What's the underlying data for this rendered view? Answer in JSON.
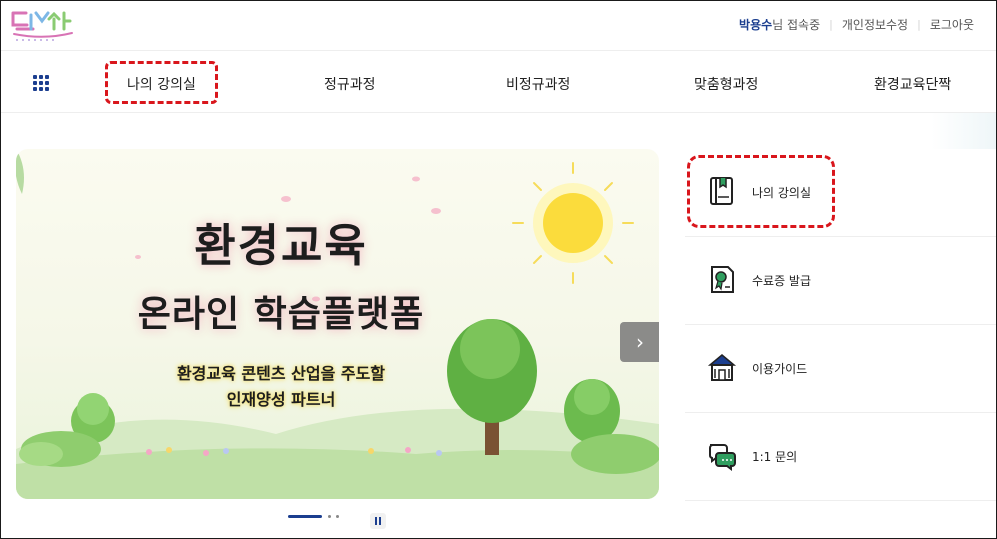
{
  "header": {
    "user_name": "박용수",
    "user_suffix": "님 접속중",
    "links": [
      "개인정보수정",
      "로그아웃"
    ]
  },
  "nav": {
    "items": [
      "나의 강의실",
      "정규과정",
      "비정규과정",
      "맞춤형과정",
      "환경교육단짝"
    ]
  },
  "banner": {
    "title": "환경교육",
    "subtitle": "온라인 학습플랫폼",
    "tagline": [
      "환경교육 콘텐츠 산업을 주도할",
      "인재양성 파트너"
    ],
    "next_icon": "chevron-right-icon"
  },
  "side_menu": {
    "items": [
      {
        "label": "나의 강의실",
        "icon": "book-icon"
      },
      {
        "label": "수료증 발급",
        "icon": "certificate-icon"
      },
      {
        "label": "이용가이드",
        "icon": "building-icon"
      },
      {
        "label": "1:1 문의",
        "icon": "chat-icon"
      }
    ]
  },
  "colors": {
    "brand": "#1b3e8f",
    "callout": "#d9161c",
    "icon_green": "#2f9e5f"
  }
}
